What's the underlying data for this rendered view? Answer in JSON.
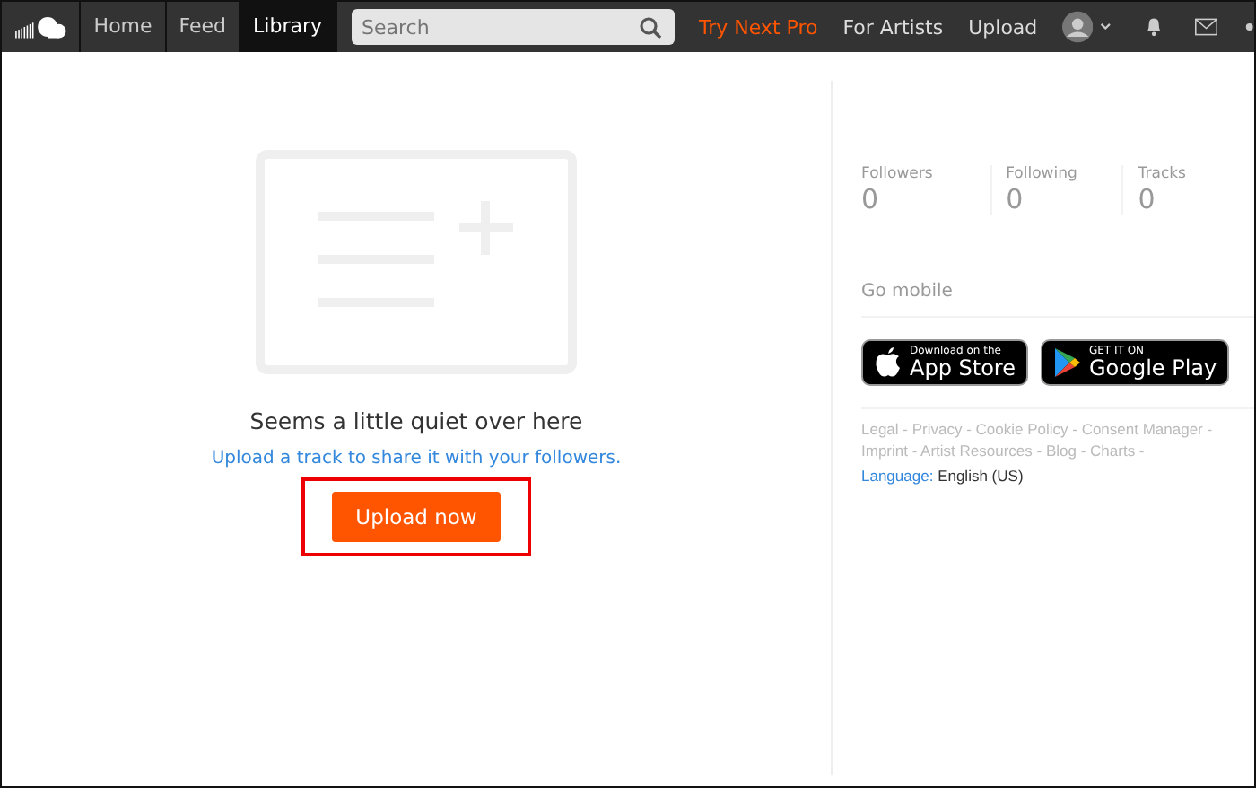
{
  "header": {
    "nav": [
      {
        "label": "Home",
        "selected": false
      },
      {
        "label": "Feed",
        "selected": false
      },
      {
        "label": "Library",
        "selected": true
      }
    ],
    "search": {
      "placeholder": "Search"
    },
    "links": [
      {
        "label": "Try Next Pro",
        "kind": "promo"
      },
      {
        "label": "For Artists",
        "kind": "plain"
      },
      {
        "label": "Upload",
        "kind": "plain"
      }
    ]
  },
  "empty_state": {
    "title": "Seems a little quiet over here",
    "link": "Upload a track to share it with your followers.",
    "button": "Upload now"
  },
  "stats": [
    {
      "label": "Followers",
      "value": "0"
    },
    {
      "label": "Following",
      "value": "0"
    },
    {
      "label": "Tracks",
      "value": "0"
    }
  ],
  "mobile": {
    "title": "Go mobile",
    "app_store": {
      "small": "Download on the",
      "large": "App Store"
    },
    "google_play": {
      "small": "GET IT ON",
      "large": "Google Play"
    }
  },
  "footer": {
    "lines": [
      "Legal - Privacy - Cookie Policy - Consent Manager -",
      "Imprint - Artist Resources - Blog - Charts -"
    ],
    "language_label": "Language:",
    "language": "English (US)"
  }
}
